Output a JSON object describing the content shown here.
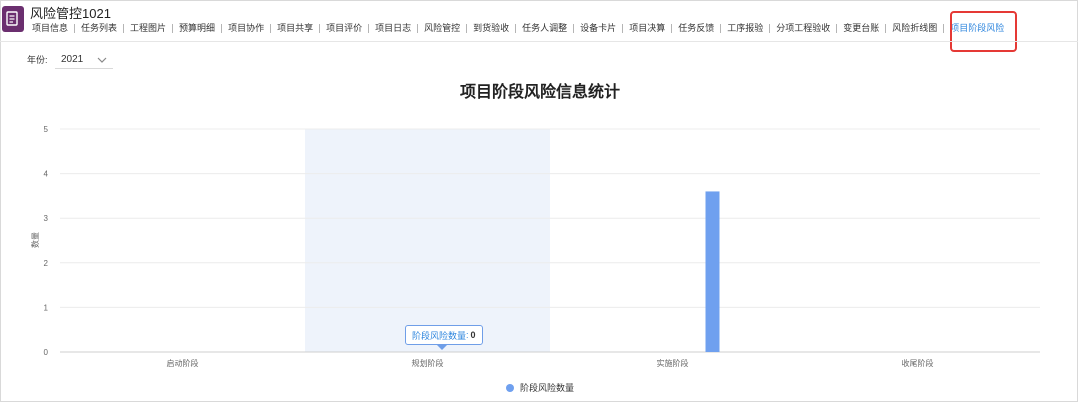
{
  "app": {
    "title": "风险管控1021"
  },
  "tabs": [
    {
      "label": "项目信息"
    },
    {
      "label": "任务列表"
    },
    {
      "label": "工程图片"
    },
    {
      "label": "预算明细"
    },
    {
      "label": "项目协作"
    },
    {
      "label": "项目共享"
    },
    {
      "label": "项目评价"
    },
    {
      "label": "项目日志"
    },
    {
      "label": "风险管控"
    },
    {
      "label": "到货验收"
    },
    {
      "label": "任务人调整"
    },
    {
      "label": "设备卡片"
    },
    {
      "label": "项目决算"
    },
    {
      "label": "任务反馈"
    },
    {
      "label": "工序报验"
    },
    {
      "label": "分项工程验收"
    },
    {
      "label": "变更台账"
    },
    {
      "label": "风险折线图"
    },
    {
      "label": "项目阶段风险"
    }
  ],
  "active_tab_index": 18,
  "filter": {
    "year_label": "年份:",
    "year_value": "2021"
  },
  "colors": {
    "accent": "#2e86de",
    "bar": "#6fa0ef",
    "highlight_band": "#eef3fb",
    "app_icon": "#6b2f6f",
    "active_box": "#e53935"
  },
  "tooltip": {
    "label": "阶段风险数量",
    "value": "0"
  },
  "chart_data": {
    "type": "bar",
    "title": "项目阶段风险信息统计",
    "categories": [
      "启动阶段",
      "规划阶段",
      "实施阶段",
      "收尾阶段"
    ],
    "series": [
      {
        "name": "阶段风险数量",
        "values": [
          0,
          0,
          3.6,
          0
        ]
      }
    ],
    "ylabel": "数量",
    "ylim": [
      0,
      5
    ],
    "yticks": [
      0,
      1,
      2,
      3,
      4,
      5
    ],
    "grid": true,
    "highlighted_category": "规划阶段",
    "legend": "bottom"
  }
}
